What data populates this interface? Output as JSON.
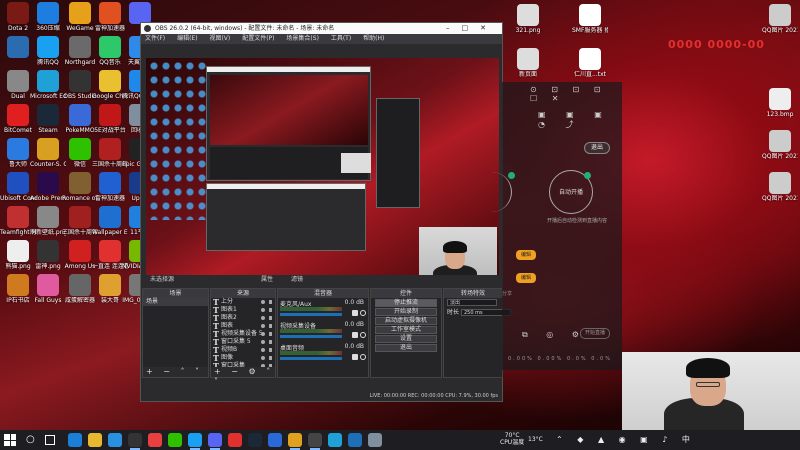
{
  "desktop": {
    "icons": [
      {
        "label": "Dota 2",
        "color": "#7a1a14"
      },
      {
        "label": "360压缩",
        "color": "#1d7ee0"
      },
      {
        "label": "WeGame",
        "color": "#e6a01a"
      },
      {
        "label": "雷神加速器",
        "color": "#e05020"
      },
      {
        "label": "",
        "color": "#5865f2"
      },
      {
        "label": "",
        "color": "#2b6cb0"
      },
      {
        "label": "腾讯QQ",
        "color": "#1aa0f0"
      },
      {
        "label": "Northgard",
        "color": "#6a6a6a"
      },
      {
        "label": "QQ音乐",
        "color": "#2cc86a"
      },
      {
        "label": "天翼云盘",
        "color": "#2e8ae6"
      },
      {
        "label": "Dual",
        "color": "#888"
      },
      {
        "label": "Microsoft Edge",
        "color": "#1fa1d8"
      },
      {
        "label": "OBS Studio",
        "color": "#333"
      },
      {
        "label": "Google Chrome",
        "color": "#e8c030"
      },
      {
        "label": "腾讯QQ7.0 (新)",
        "color": "#2088e8"
      },
      {
        "label": "BitComet",
        "color": "#e02020"
      },
      {
        "label": "Steam",
        "color": "#1b2838"
      },
      {
        "label": "PokeMMO",
        "color": "#3a6ad8"
      },
      {
        "label": "5E对战平台",
        "color": "#c01818"
      },
      {
        "label": "回收站",
        "color": "#7f8fa0"
      },
      {
        "label": "鲁大师",
        "color": "#2a7ae0"
      },
      {
        "label": "Counter-S. Global Offe.",
        "color": "#d8a020"
      },
      {
        "label": "微信",
        "color": "#2dc100"
      },
      {
        "label": "三国杀十周年",
        "color": "#b02020"
      },
      {
        "label": "Epic Games Launcher",
        "color": "#222"
      },
      {
        "label": "Ubisoft Connect",
        "color": "#2050c0"
      },
      {
        "label": "Adobe Premiere...",
        "color": "#2a0a4a"
      },
      {
        "label": "Romance of the Three...",
        "color": "#806030"
      },
      {
        "label": "雷神加速器",
        "color": "#2060d0"
      },
      {
        "label": "Uplay",
        "color": "#1a3a8a"
      },
      {
        "label": "Teamfight Manager",
        "color": "#c03030"
      },
      {
        "label": "刷新壁纸.png",
        "color": "#888"
      },
      {
        "label": "三国杀十周年",
        "color": "#a02020"
      },
      {
        "label": "Wallpaper Engine",
        "color": "#1f6fd0"
      },
      {
        "label": "11平台",
        "color": "#2080e0"
      },
      {
        "label": "熊猫.png",
        "color": "#eee"
      },
      {
        "label": "雷神.png",
        "color": "#333"
      },
      {
        "label": "Among Us",
        "color": "#d02020"
      },
      {
        "label": "一直连 连连看",
        "color": "#e03030"
      },
      {
        "label": "NVIDIA GeForce...",
        "color": "#76b900"
      },
      {
        "label": "IP石书店",
        "color": "#d07a20"
      },
      {
        "label": "Fall Guys",
        "color": "#e05aa0"
      },
      {
        "label": "咸蛋解密器",
        "color": "#666"
      },
      {
        "label": "装大哥",
        "color": "#e0a030"
      },
      {
        "label": "IMG_0278...",
        "color": "#777"
      }
    ],
    "right_icons": [
      {
        "label": "321.png",
        "color": "#ddd"
      },
      {
        "label": "SMF服务器 播.tmbx",
        "color": "#fff"
      },
      {
        "label": "新页面",
        "color": "#ddd"
      },
      {
        "label": "仁川直...txt",
        "color": "#fff"
      },
      {
        "label": "QQ图片 2021025...",
        "color": "#ccc"
      },
      {
        "label": "123.bmp",
        "color": "#eee"
      },
      {
        "label": "QQ图片 2021011...",
        "color": "#ccc"
      },
      {
        "label": "QQ图片 2021023...",
        "color": "#ccc"
      }
    ]
  },
  "obs": {
    "title": "OBS 26.0.2 (64-bit, windows) - 配置文件: 未命名 - 场景: 未命名",
    "menu": [
      "文件(F)",
      "编辑(E)",
      "视图(V)",
      "配置文件(P)",
      "场景集合(S)",
      "工具(T)",
      "帮助(H)"
    ],
    "preview_status": "未选择源",
    "preview_tabs": [
      "属性",
      "滤镜"
    ],
    "scenes": {
      "header": "场景",
      "items": [
        "场景"
      ]
    },
    "sources": {
      "header": "来源",
      "items": [
        "上分",
        "图表1",
        "图表2",
        "图表",
        "视频采集设备 5",
        "窗口采集 5",
        "视频B",
        "图像",
        "窗口采集",
        "显示采集"
      ]
    },
    "mixer": {
      "header": "混音器",
      "rows": [
        {
          "name": "麦克风/Aux",
          "db": "0.0 dB"
        },
        {
          "name": "视频采集设备",
          "db": "0.0 dB"
        },
        {
          "name": "桌面音频",
          "db": "0.0 dB"
        }
      ]
    },
    "controls": {
      "header": "控件",
      "buttons": [
        "停止推流",
        "开始录制",
        "启动虚拟摄像机",
        "工作室模式",
        "设置",
        "退出"
      ]
    },
    "transitions": {
      "header": "转场特效",
      "type": "淡出",
      "duration_label": "时长",
      "duration": "250 ms"
    },
    "statusbar": "LIVE: 00:00:00   REC: 00:00:00   CPU: 7.9%, 30.00 fps"
  },
  "streamer": {
    "exit_label": "退出",
    "auto_label": "自动开播",
    "hint": "开播后自动检测到直播内容",
    "orange_labels": [
      "编辑",
      "编辑"
    ],
    "share_label": "分享",
    "faded_button": "开始直播",
    "stats": "0.00%   0.00%   0.0%   0.0%"
  },
  "overlay_text": "0000 0000-00",
  "taskbar": {
    "search_glyph": "○",
    "temp": "70°C",
    "temp_label": "CPU温度",
    "weather": "13°C",
    "tray_glyphs": "⌃ ◆ ▲ ◉ ▣ ♪ 中"
  }
}
